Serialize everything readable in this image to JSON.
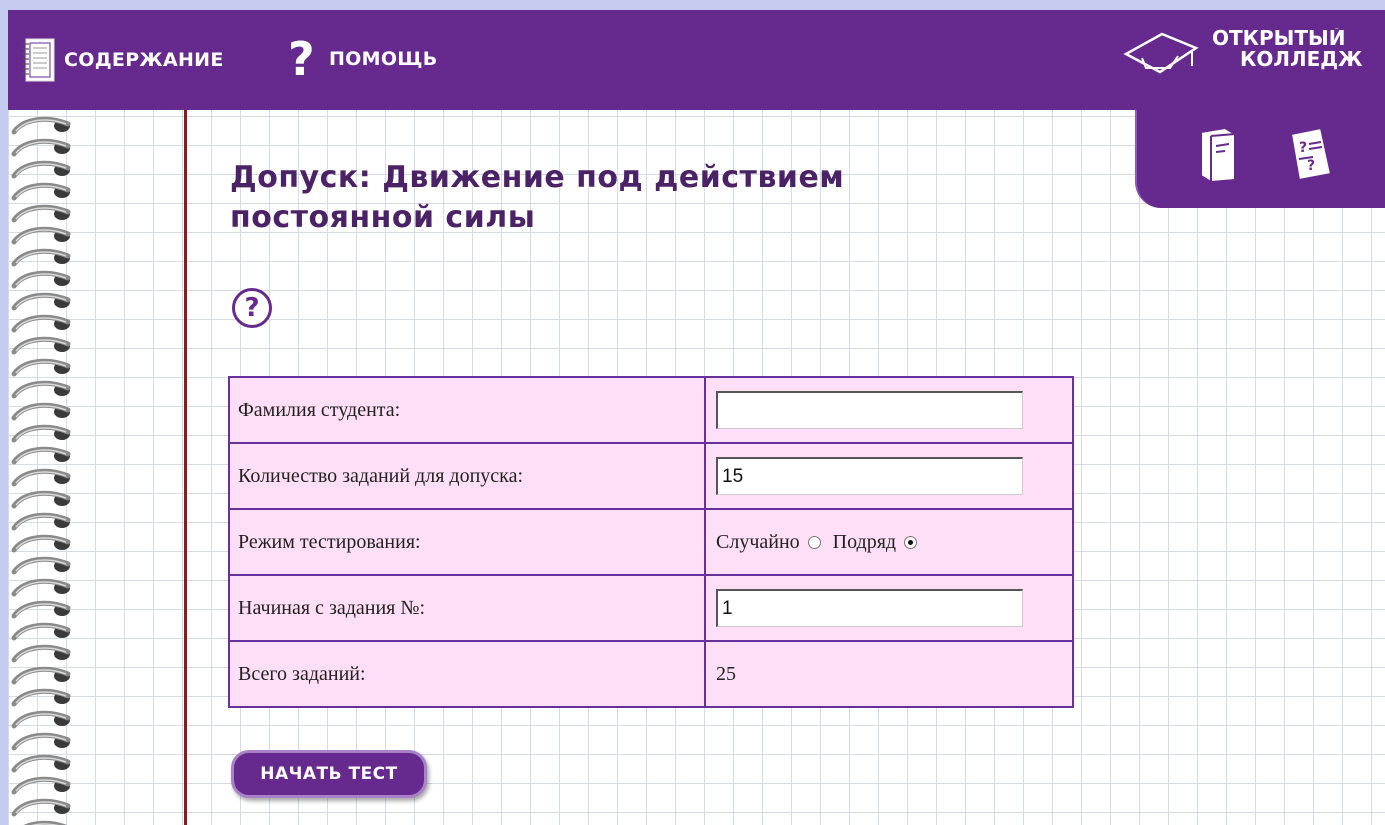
{
  "header": {
    "contents_label": "СОДЕРЖАНИЕ",
    "help_label": "ПОМОЩЬ",
    "help_glyph": "?",
    "logo_line1": "ОТКРЫТЫЙ",
    "logo_line2": "КОЛЛЕДЖ"
  },
  "page": {
    "title_line1": "Допуск: Движение под действием",
    "title_line2": "постоянной силы",
    "help_button_glyph": "?"
  },
  "form": {
    "rows": [
      {
        "label": "Фамилия студента:",
        "value": ""
      },
      {
        "label": "Количество заданий для допуска:",
        "value": "15"
      },
      {
        "label": "Режим тестирования:"
      },
      {
        "label": "Начиная с задания №:",
        "value": "1"
      },
      {
        "label": "Всего заданий:",
        "value": "25"
      }
    ],
    "mode_options": [
      {
        "label": "Случайно",
        "selected": false
      },
      {
        "label": "Подряд",
        "selected": true
      }
    ]
  },
  "buttons": {
    "start_label": "НАЧАТЬ ТЕСТ"
  },
  "colors": {
    "brand_purple": "#662a8e",
    "form_background": "#ffdff7",
    "margin_red": "#8b1a1a",
    "window_background": "#c5cbef"
  },
  "icons": {
    "contents": "notebook-icon",
    "help": "question-mark-icon",
    "logo": "graduation-cap-icon",
    "theory": "book-icon",
    "tasks": "task-sheet-icon"
  }
}
